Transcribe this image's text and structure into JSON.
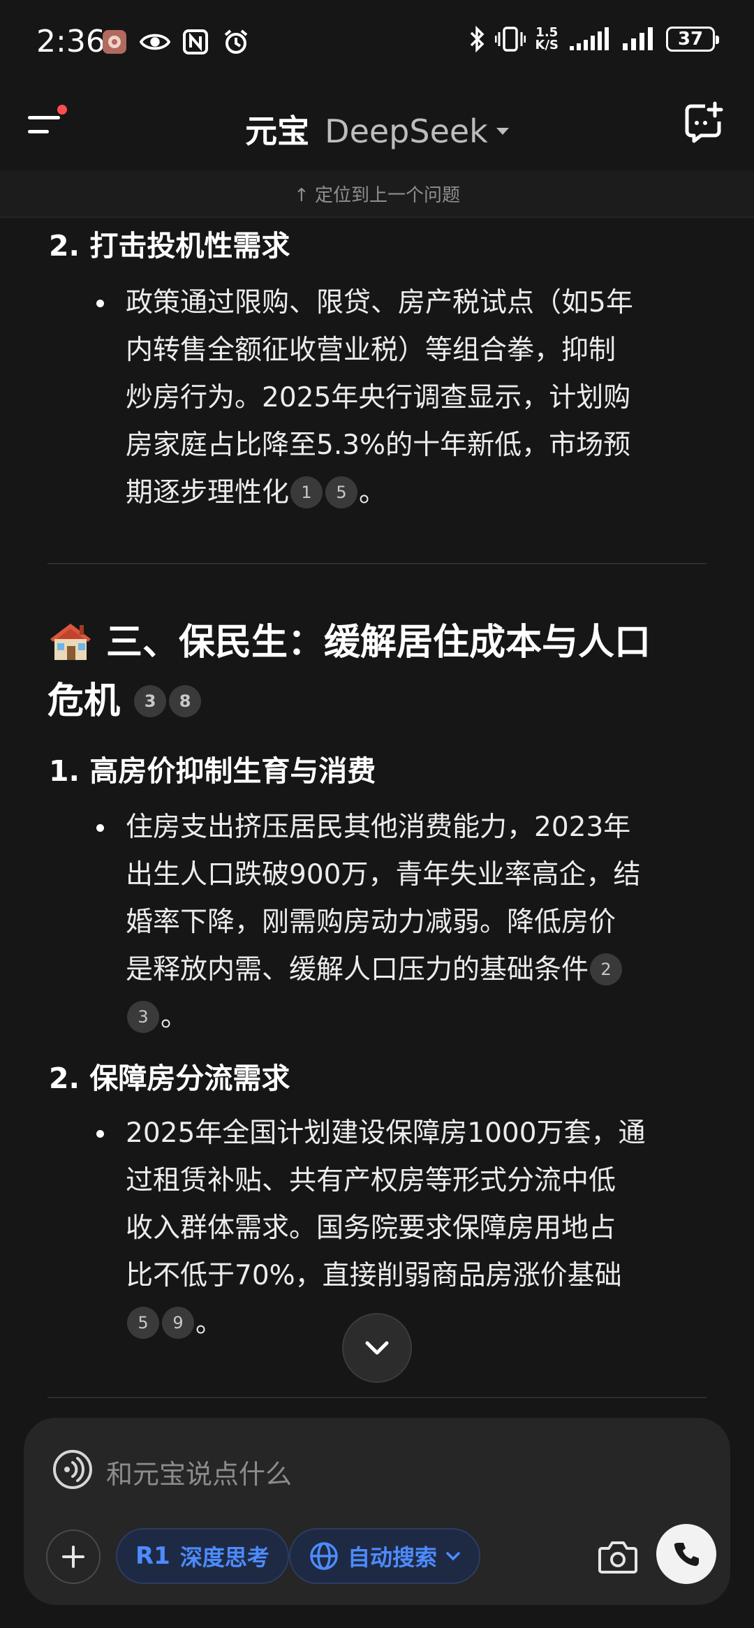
{
  "status_bar": {
    "time": "2:36",
    "net_speed_top": "1.5",
    "net_speed_unit": "K/S",
    "battery": "37"
  },
  "header": {
    "app_name": "元宝",
    "model_name": "DeepSeek"
  },
  "locate_banner": "↑ 定位到上一个问题",
  "content": {
    "item2_title": "2. 打击投机性需求",
    "item2_lines": [
      "政策通过限购、限贷、房产税试点（如5年",
      "内转售全额征收营业税）等组合拳，抑制",
      "炒房行为。2025年央行调查显示，计划购",
      "房家庭占比降至5.3%的十年新低，市场预",
      "期逐步理性化"
    ],
    "item2_cites": [
      "1",
      "5"
    ],
    "item2_end": "。",
    "section3_title_line1": "三、保民生：缓解居住成本与人口",
    "section3_title_line2": "危机",
    "section3_cites": [
      "3",
      "8"
    ],
    "s3_item1_title": "1. 高房价抑制生育与消费",
    "s3_item1_lines": [
      "住房支出挤压居民其他消费能力，2023年",
      "出生人口跌破900万，青年失业率高企，结",
      "婚率下降，刚需购房动力减弱。降低房价",
      "是释放内需、缓解人口压力的基础条件"
    ],
    "s3_item1_cite_a": "2",
    "s3_item1_cite_b": "3",
    "s3_item1_end": "。",
    "s3_item2_title": "2. 保障房分流需求",
    "s3_item2_lines": [
      "2025年全国计划建设保障房1000万套，通",
      "过租赁补贴、共有产权房等形式分流中低",
      "收入群体需求。国务院要求保障房用地占",
      "比不低于70%，直接削弱商品房涨价基础"
    ],
    "s3_item2_cites": [
      "5",
      "9"
    ],
    "s3_item2_end": "。"
  },
  "composer": {
    "placeholder": "和元宝说点什么",
    "deep_think_badge": "R1",
    "deep_think_label": "深度思考",
    "auto_search_label": "自动搜索"
  },
  "colors": {
    "background": "#161616",
    "accent_blue": "#4d8bff",
    "notification_dot": "#ff4d4f"
  }
}
